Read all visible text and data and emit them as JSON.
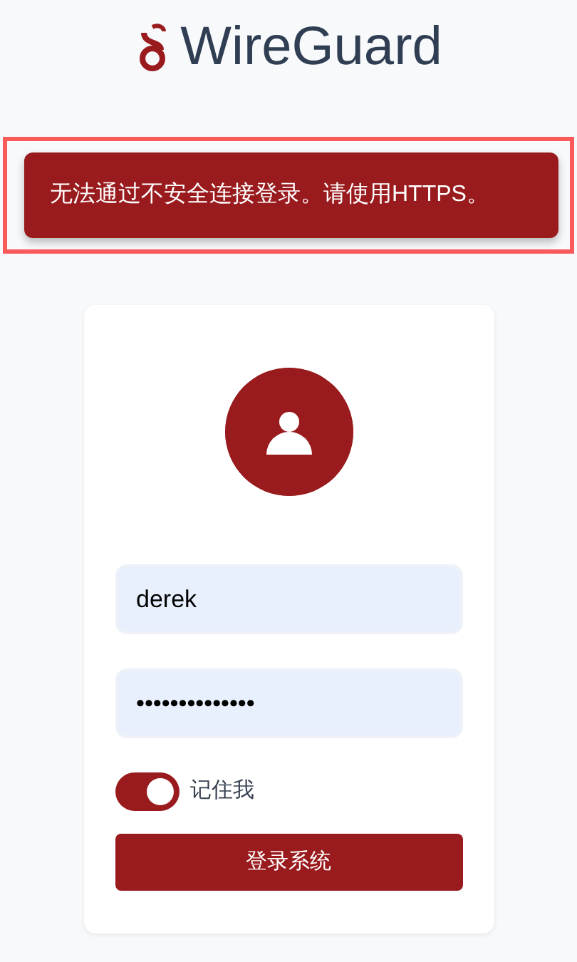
{
  "header": {
    "title": "WireGuard"
  },
  "alert": {
    "message": "无法通过不安全连接登录。请使用HTTPS。",
    "highlighted": true
  },
  "login": {
    "username": {
      "value": "derek"
    },
    "password": {
      "value": "••••••••••••••"
    },
    "remember": {
      "label": "记住我",
      "on": true
    },
    "submit": {
      "label": "登录系统"
    }
  }
}
